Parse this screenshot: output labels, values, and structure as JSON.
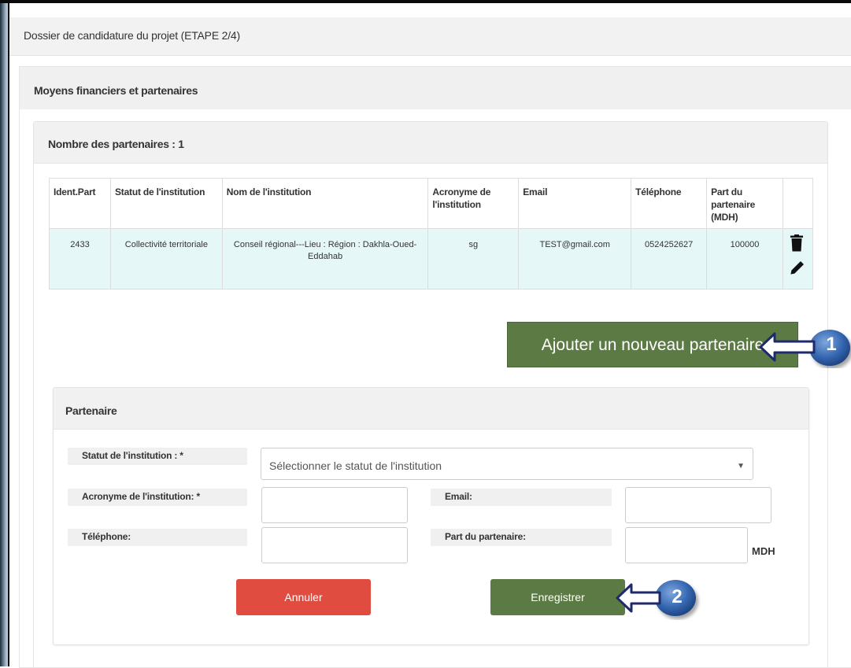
{
  "page": {
    "title": "Dossier de candidature du projet (ETAPE 2/4)"
  },
  "section": {
    "title": "Moyens financiers et partenaires"
  },
  "partners": {
    "count_label": "Nombre des partenaires : 1",
    "columns": [
      "Ident.Part",
      "Statut de l'institution",
      "Nom de l'institution",
      "Acronyme de l'institution",
      "Email",
      "Téléphone",
      "Part du partenaire (MDH)",
      ""
    ],
    "rows": [
      {
        "id": "2433",
        "statut": "Collectivité territoriale",
        "nom": "Conseil régional---Lieu : Région : Dakhla-Oued-Eddahab",
        "acronyme": "sg",
        "email": "TEST@gmail.com",
        "telephone": "0524252627",
        "part": "100000",
        "actions": [
          "trash-icon",
          "pencil-icon"
        ]
      }
    ],
    "add_button": "Ajouter un nouveau partenaire"
  },
  "callouts": {
    "first": "1",
    "second": "2"
  },
  "form": {
    "title": "Partenaire",
    "statut_label": "Statut de l'institution : *",
    "statut_placeholder": "Sélectionner le statut de l'institution",
    "acronyme_label": "Acronyme de l'institution: *",
    "email_label": "Email:",
    "telephone_label": "Téléphone:",
    "part_label": "Part du partenaire:",
    "part_unit": "MDH",
    "acronyme_value": "",
    "email_value": "",
    "telephone_value": "",
    "part_value": "",
    "cancel_label": "Annuler",
    "save_label": "Enregistrer"
  },
  "colors": {
    "primary_green": "#5c7a44",
    "danger_red": "#e04c3f",
    "row_highlight": "#e6f7f7",
    "callout_blue": "#2c5aa0"
  }
}
